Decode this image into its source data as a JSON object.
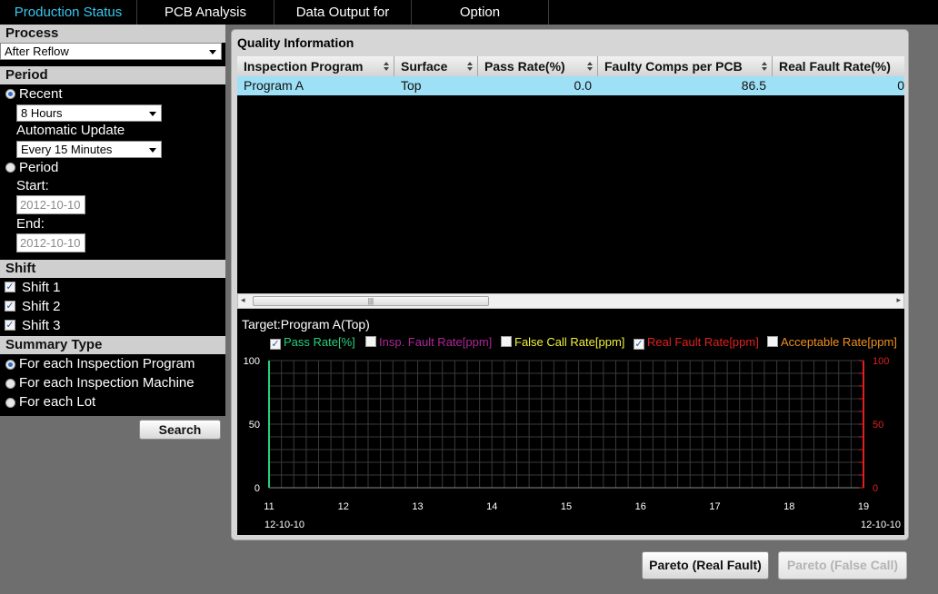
{
  "tabs": [
    "Production Status",
    "PCB Analysis",
    "Data Output for Report",
    "Option"
  ],
  "sidebar": {
    "process": {
      "heading": "Process",
      "selected": "After Reflow"
    },
    "period": {
      "heading": "Period",
      "recent_label": "Recent",
      "recent_value": "8 Hours",
      "auto_update_label": "Automatic Update",
      "auto_update_value": "Every 15 Minutes",
      "period_label": "Period",
      "start_label": "Start:",
      "start_value": "2012-10-10",
      "end_label": "End:",
      "end_value": "2012-10-10"
    },
    "shift": {
      "heading": "Shift",
      "items": [
        "Shift 1",
        "Shift 2",
        "Shift 3"
      ]
    },
    "summary": {
      "heading": "Summary Type",
      "items": [
        "For each Inspection Program",
        "For each Inspection Machine",
        "For each Lot"
      ],
      "selected_index": 0
    },
    "search_label": "Search"
  },
  "quality": {
    "title": "Quality Information",
    "columns": [
      "Inspection Program",
      "Surface",
      "Pass Rate(%)",
      "Faulty Comps per PCB",
      "Real Fault Rate(%)"
    ],
    "rows": [
      {
        "program": "Program A",
        "surface": "Top",
        "pass_rate": "0.0",
        "faulty_comps": "86.5",
        "real_fault": "0"
      }
    ]
  },
  "chart_panel": {
    "target": "Target:Program A(Top)",
    "legend": [
      {
        "label": "Pass Rate[%]",
        "checked": true,
        "color": "#26d07c"
      },
      {
        "label": "Insp. Fault Rate[ppm]",
        "checked": false,
        "color": "#b0259a"
      },
      {
        "label": "False Call Rate[ppm]",
        "checked": false,
        "color": "#f2f23a"
      },
      {
        "label": "Real Fault Rate[ppm]",
        "checked": true,
        "color": "#e02020"
      },
      {
        "label": "Acceptable Rate[ppm]",
        "checked": false,
        "color": "#f0901c"
      }
    ]
  },
  "chart_data": {
    "type": "line",
    "x_ticks": [
      "11",
      "12",
      "13",
      "14",
      "15",
      "16",
      "17",
      "18",
      "19"
    ],
    "x_start_date": "12-10-10",
    "x_end_date": "12-10-10",
    "y_left_ticks": [
      "0",
      "50",
      "100"
    ],
    "y_right_ticks": [
      "0",
      "50",
      "100"
    ],
    "y_left_color": "#26d07c",
    "y_right_color": "#e02020",
    "ylim": [
      0,
      100
    ],
    "grid": true,
    "series": [
      {
        "name": "Pass Rate[%]",
        "color": "#26d07c",
        "values": []
      },
      {
        "name": "Real Fault Rate[ppm]",
        "color": "#e02020",
        "values": []
      }
    ]
  },
  "buttons": {
    "pareto_real": "Pareto (Real Fault)",
    "pareto_false": "Pareto (False Call)"
  }
}
